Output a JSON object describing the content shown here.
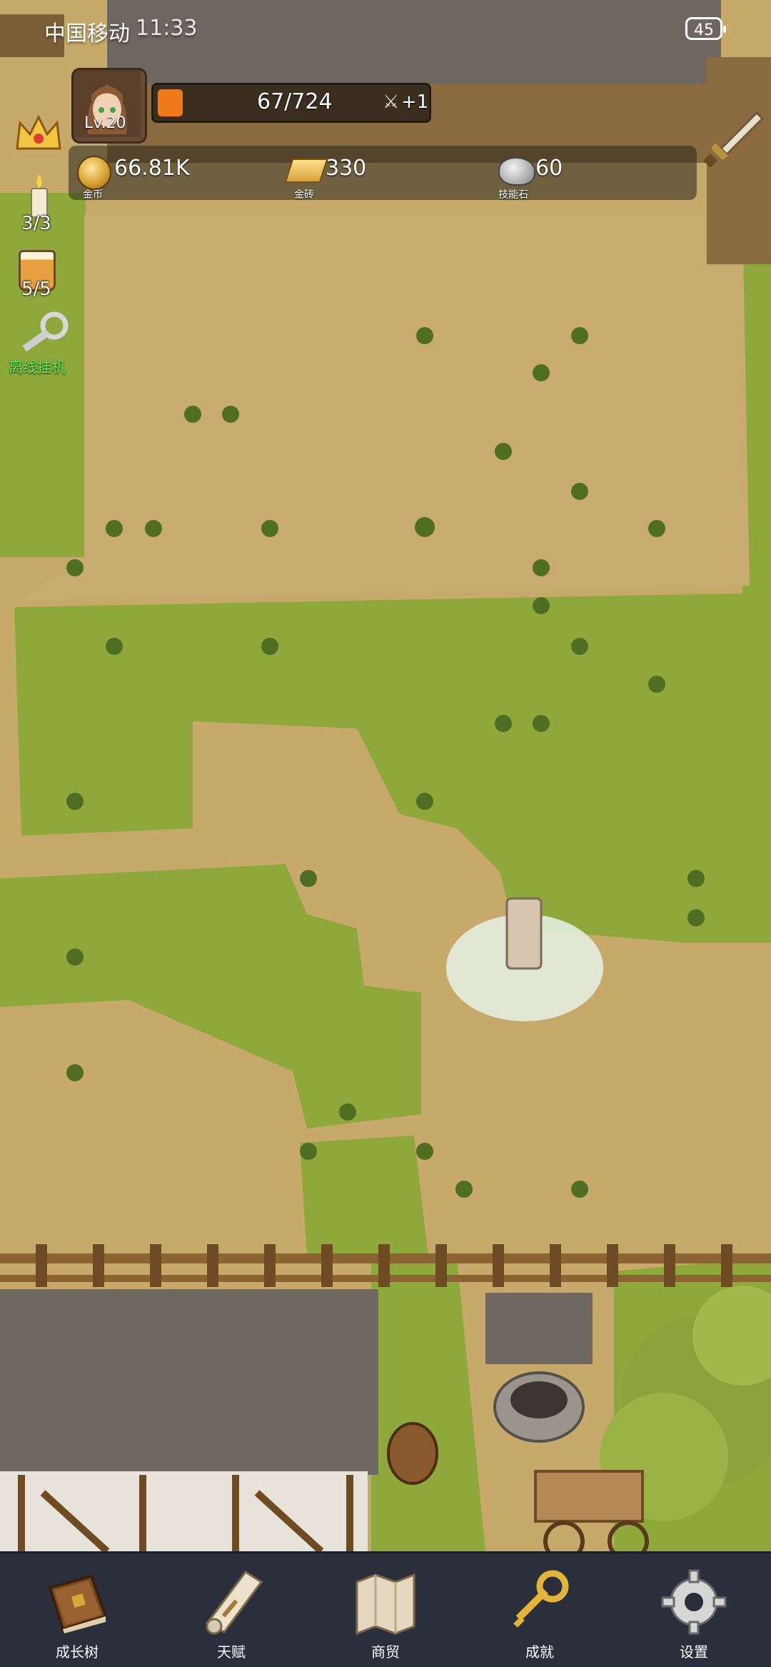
{
  "status_bar": {
    "carrier": "中国移动",
    "time": "11:33",
    "battery": "45"
  },
  "player": {
    "level": "Lv.20",
    "hp_text": "67/724",
    "hp_fraction": 0.093,
    "regen": "+1"
  },
  "resources": [
    {
      "icon": "coin-icon",
      "value": "66.81K",
      "label": "金币"
    },
    {
      "icon": "gold-bar-icon",
      "value": "330",
      "label": "金砖"
    },
    {
      "icon": "skill-stone-icon",
      "value": "60",
      "label": "技能石"
    }
  ],
  "side_buttons": {
    "candle_count": "3/3",
    "cup_count": "5/5",
    "afk_label": "离线挂机"
  },
  "nav": [
    {
      "icon": "book-icon",
      "label": "成长树"
    },
    {
      "icon": "scroll-icon",
      "label": "天赋"
    },
    {
      "icon": "map-icon",
      "label": "商贸"
    },
    {
      "icon": "key-icon",
      "label": "成就"
    },
    {
      "icon": "gear-icon",
      "label": "设置"
    }
  ],
  "colors": {
    "dirt": "#c6a96b",
    "grass": "#8fa83c",
    "nav_bg": "#2a2f3b",
    "hp_fill": "#f07a1a",
    "afk_text": "#5df05a"
  }
}
